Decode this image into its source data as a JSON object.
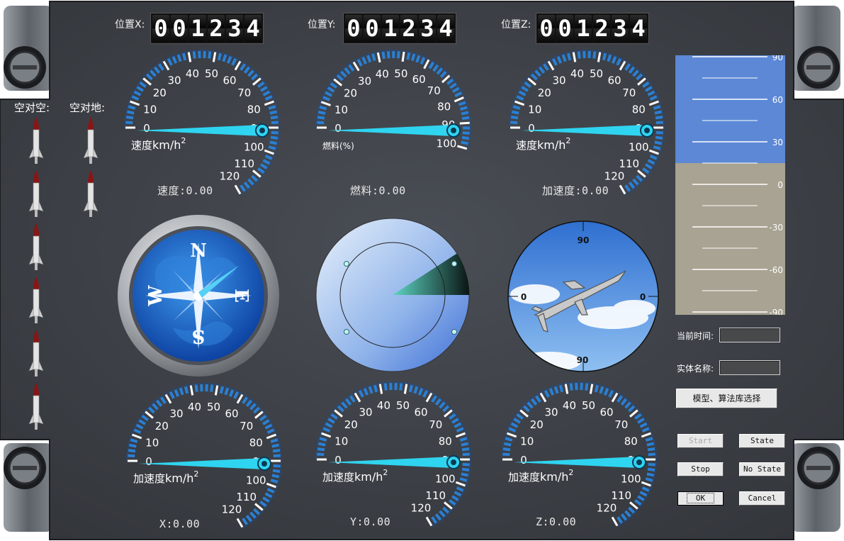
{
  "position_counters": [
    {
      "label": "位置X:",
      "digits": [
        "0",
        "0",
        "1",
        "2",
        "3",
        "4"
      ]
    },
    {
      "label": "位置Y:",
      "digits": [
        "0",
        "0",
        "1",
        "2",
        "3",
        "4"
      ]
    },
    {
      "label": "位置Z:",
      "digits": [
        "0",
        "0",
        "1",
        "2",
        "3",
        "4"
      ]
    }
  ],
  "missiles": {
    "air_to_air_label": "空对空:",
    "air_to_ground_label": "空对地:",
    "air_to_air_count": 6,
    "air_to_ground_count": 2
  },
  "gauges": {
    "scale_labels": [
      "0",
      "10",
      "20",
      "30",
      "40",
      "50",
      "60",
      "70",
      "80",
      "90",
      "100",
      "110",
      "120"
    ],
    "fuel_scale_labels": [
      "0",
      "10",
      "20",
      "30",
      "40",
      "50",
      "60",
      "70",
      "80",
      "90",
      "100"
    ],
    "unit_km": "km/h",
    "unit_sup": "2",
    "speed_name": "速度",
    "fuel_name": "燃料(%)",
    "accel_name": "加速度",
    "speed_readout": "速度:0.00",
    "fuel_readout": "燃料:0.00",
    "accel_readout": "加速度:0.00",
    "x_readout": "X:0.00",
    "y_readout": "Y:0.00",
    "z_readout": "Z:0.00",
    "needle_value": 0
  },
  "compass": {
    "n": "N",
    "e": "E",
    "s": "S",
    "w": "W",
    "heading_deg": 45
  },
  "attitude": {
    "top": "90",
    "bottom": "90",
    "left": "0",
    "right": "0"
  },
  "altitude_scale": {
    "labels": [
      "90",
      "60",
      "30",
      "0",
      "-30",
      "-60",
      "-90"
    ]
  },
  "side_panel": {
    "time_label": "当前时间:",
    "time_value": "",
    "entity_label": "实体名称:",
    "entity_value": "",
    "model_button": "模型、算法库选择",
    "start": "Start",
    "state": "State",
    "stop": "Stop",
    "no_state": "No State",
    "ok": "OK",
    "cancel": "Cancel"
  },
  "colors": {
    "panel": "#3e4248",
    "needle": "#2fd4f0",
    "sky": "#5c88d6",
    "ground": "#a8a392",
    "tick_blue": "#2a7fd4"
  }
}
